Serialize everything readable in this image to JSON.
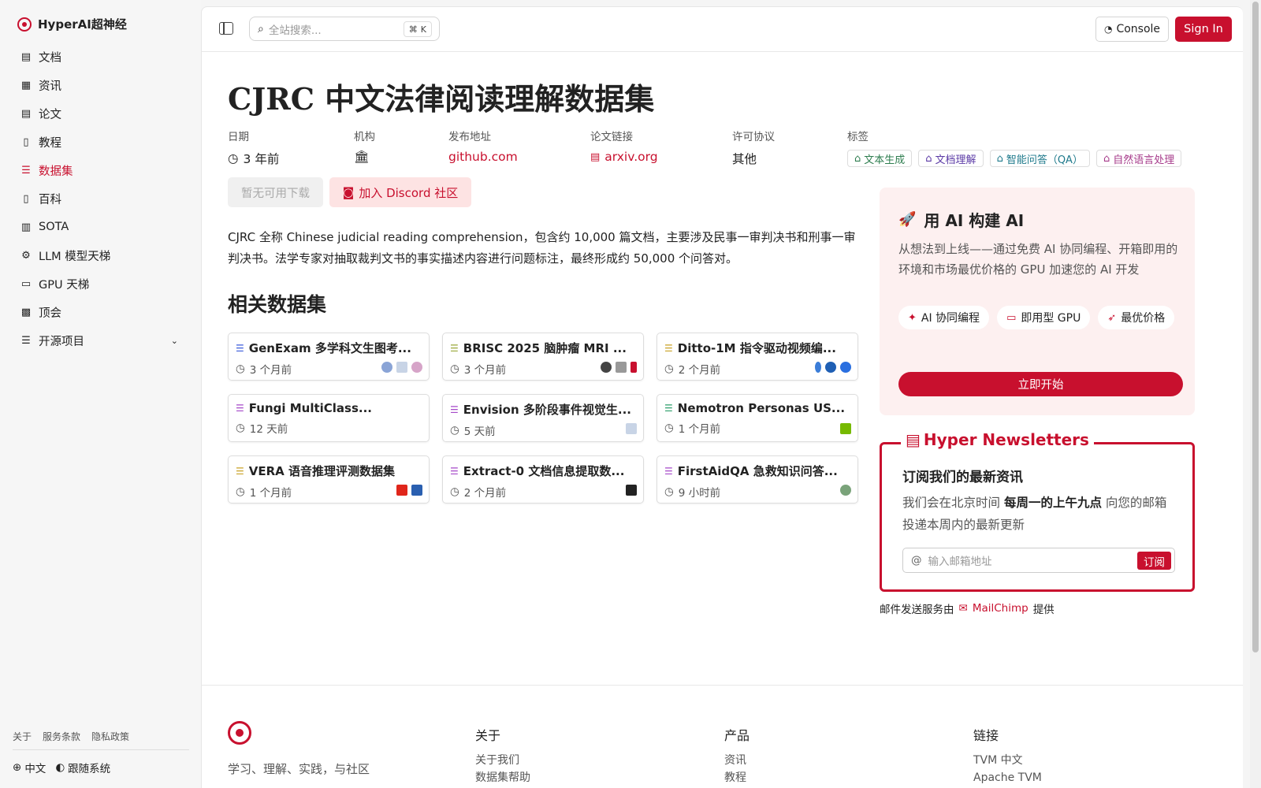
{
  "brand": {
    "name": "HyperAI超神经"
  },
  "sidebar": {
    "items": [
      {
        "label": "文档",
        "icon": "doc-icon"
      },
      {
        "label": "资讯",
        "icon": "news-icon"
      },
      {
        "label": "论文",
        "icon": "paper-icon"
      },
      {
        "label": "教程",
        "icon": "tutorial-icon"
      },
      {
        "label": "数据集",
        "icon": "database-icon"
      },
      {
        "label": "百科",
        "icon": "wiki-icon"
      },
      {
        "label": "SOTA",
        "icon": "chart-icon"
      },
      {
        "label": "LLM 模型天梯",
        "icon": "llm-icon"
      },
      {
        "label": "GPU 天梯",
        "icon": "gpu-icon"
      },
      {
        "label": "顶会",
        "icon": "conference-icon"
      },
      {
        "label": "开源项目",
        "icon": "list-icon"
      }
    ],
    "footer_links": [
      "关于",
      "服务条款",
      "隐私政策"
    ],
    "language": "中文",
    "theme": "跟随系统"
  },
  "topbar": {
    "search_placeholder": "全站搜索...",
    "search_shortcut": "K",
    "console_label": "Console",
    "signin_label": "Sign In"
  },
  "page": {
    "title": "CJRC 中文法律阅读理解数据集",
    "meta": {
      "date_label": "日期",
      "date_value": "3 年前",
      "org_label": "机构",
      "publish_label": "发布地址",
      "publish_value": "github.com",
      "paper_label": "论文链接",
      "paper_value": "arxiv.org",
      "license_label": "许可协议",
      "license_value": "其他",
      "tags_label": "标签",
      "tags": [
        "文本生成",
        "文档理解",
        "智能问答（QA）",
        "自然语言处理"
      ]
    },
    "download_label": "暂无可用下载",
    "discord_label": "加入 Discord 社区",
    "description": "CJRC 全称 Chinese judicial reading comprehension，包含约 10,000 篇文档，主要涉及民事一审判决书和刑事一审判决书。法学专家对抽取裁判文书的事实描述内容进行问题标注，最终形成约 50,000 个问答对。",
    "related_title": "相关数据集",
    "related": [
      {
        "title": "GenExam 多学科文生图考...",
        "time": "3 个月前"
      },
      {
        "title": "BRISC 2025 脑肿瘤 MRI ...",
        "time": "3 个月前"
      },
      {
        "title": "Ditto-1M 指令驱动视频编...",
        "time": "2 个月前"
      },
      {
        "title": "Fungi MultiClass...",
        "time": "12 天前"
      },
      {
        "title": "Envision 多阶段事件视觉生...",
        "time": "5 天前"
      },
      {
        "title": "Nemotron Personas US...",
        "time": "1 个月前"
      },
      {
        "title": "VERA 语音推理评测数据集",
        "time": "1 个月前"
      },
      {
        "title": "Extract-0 文档信息提取数...",
        "time": "2 个月前"
      },
      {
        "title": "FirstAidQA 急救知识问答...",
        "time": "9 小时前"
      }
    ]
  },
  "promo": {
    "title": "用 AI 构建 AI",
    "description": "从想法到上线——通过免费 AI 协同编程、开箱即用的环境和市场最优价格的 GPU 加速您的 AI 开发",
    "chips": [
      "AI 协同编程",
      "即用型 GPU",
      "最优价格"
    ],
    "cta": "立即开始"
  },
  "newsletter": {
    "legend": "Hyper Newsletters",
    "heading": "订阅我们的最新资讯",
    "desc_pre": "我们会在北京时间 ",
    "desc_bold": "每周一的上午九点",
    "desc_post": " 向您的邮箱投递本周内的最新更新",
    "placeholder": "输入邮箱地址",
    "subscribe": "订阅",
    "provider_pre": "邮件发送服务由",
    "provider": "MailChimp",
    "provider_post": "提供"
  },
  "footer": {
    "tagline": "学习、理解、实践，与社区",
    "col_about": {
      "title": "关于",
      "links": [
        "关于我们",
        "数据集帮助"
      ]
    },
    "col_product": {
      "title": "产品",
      "links": [
        "资讯",
        "教程"
      ]
    },
    "col_links": {
      "title": "链接",
      "links": [
        "TVM 中文",
        "Apache TVM"
      ]
    }
  },
  "colors": {
    "accent": "#c8102e"
  }
}
